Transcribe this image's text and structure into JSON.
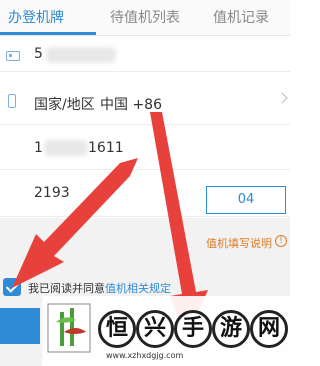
{
  "tabs": [
    "办登机牌",
    "待值机列表",
    "值机记录"
  ],
  "form": {
    "id_prefix": "5",
    "country_label": "国家/地区",
    "country_value": "中国 +86",
    "phone_prefix": "1",
    "phone_suffix": "1611",
    "code_input": "2193",
    "code_button": "04"
  },
  "help_link": "值机填写说明",
  "help_icon": "!",
  "agree_text": "我已阅读并同意",
  "agree_link": "值机相关规定",
  "watermark": {
    "chars": [
      "恒",
      "兴",
      "手",
      "游",
      "网"
    ],
    "url": "www.xzhxdgjg.com"
  },
  "colors": {
    "accent": "#2f8bd6",
    "arrow": "#e8413c",
    "help": "#e07b25"
  }
}
